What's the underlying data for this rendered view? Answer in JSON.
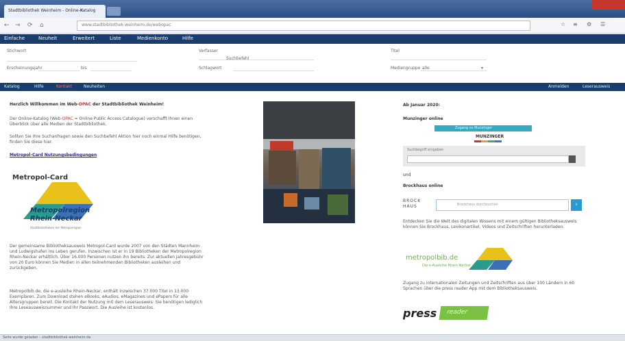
{
  "browser": {
    "tab_title": "Stadtbibliothek Weinheim - Online-Katalog",
    "tab_close": "×",
    "url": "www.stadtbibliothek-weinheim.de/webopac",
    "nav_back": "←",
    "nav_forward": "→",
    "nav_reload": "⟳",
    "nav_home": "⌂"
  },
  "catalog_nav": {
    "items": [
      "Einfache",
      "Neuheit",
      "Erweitert",
      "Liste",
      "Medienkonto",
      "Hilfe"
    ]
  },
  "search_form": {
    "fields": [
      {
        "label": "Stichwort"
      },
      {
        "label": "Verfasser"
      },
      {
        "label": "Titel"
      },
      {
        "label": "Erscheinungsjahr"
      },
      {
        "label": "Schlagwort"
      },
      {
        "label": "Mediengruppe"
      }
    ],
    "range_to": "bis",
    "mid_hint": "Suchbefehl",
    "select_placeholder": "alle"
  },
  "link_bar": {
    "left": [
      "Katalog",
      "Hilfe",
      "Kontakt",
      "Neuheiten"
    ],
    "right": [
      "Anmelden",
      "Leserausweis"
    ]
  },
  "main": {
    "welcome_prefix": "Herzlich Willkommen im Web-",
    "welcome_highlight": "OPAC",
    "welcome_suffix": " der Stadtbibliothek Weinheim!",
    "para1_prefix": "Der Online-Katalog (Web-",
    "para1_highlight": "OPAC",
    "para1_suffix": " = Online Public Access Catalogue) verschafft Ihnen einen Überblick über alle Medien der Stadtbibliothek.",
    "para2": "Sollten Sie Ihre Suchanfragen sowie den Suchbefehl Aktion hier noch einmal Hilfe benötigen, finden Sie diese hier.",
    "link": "Metropol-Card Nutzungsbedingungen",
    "metropol_card": {
      "card_label": "Metropol-Card",
      "region_line1": "Metropolregion",
      "region_line2": "Rhein-Neckar",
      "fineprint": "Stadtbibliotheken der Metropolregion"
    },
    "para3": "Der gemeinsame Bibliotheksausweis Metropol-Card wurde 2007 von den Städten Mannheim und Ludwigshafen ins Leben gerufen. Inzwischen ist er in 19 Bibliotheken der Metropolregion Rhein-Neckar erhältlich. Über 16.000 Personen nutzen ihn bereits. Zur aktuellen Jahresgebühr von 20 Euro können Sie Medien in allen teilnehmenden Bibliotheken ausleihen und zurückgeben.",
    "para4": "Metropolbib.de, die e-ausleihe Rhein-Neckar, enthält inzwischen 37.000 Titel in 13.000 Exemplaren. Zum Download stehen eBooks, eAudios, eMagazines und ePapers für alle Altersgruppen bereit. Die Kontakt der Nutzung mit dem Leserausweis: Sie benötigen lediglich Ihre Leseausweisnummer und Ihr Passwort. Die Ausleihe ist kostenlos."
  },
  "sidebar": {
    "heading_news": "Ab Januar 2020:",
    "heading_munz": "Munzinger online",
    "munzinger": {
      "bar_text": "Zugang zu Munzinger",
      "name": "MUNZINGER"
    },
    "munz_form_label": "Suchbegriff eingeben",
    "and_text": "und",
    "heading_brock": "Brockhaus online",
    "brockhaus_logo": "BROCK\nHAUS",
    "brockhaus_placeholder": "Brockhaus durchsuchen",
    "brockhaus_go": "›",
    "text_brock": "Entdecken Sie die Welt des digitalen Wissens mit einem gültigen Bibliotheksausweis können Sie Brockhaus, Lexikonartikel, Videos und Zeitschriften herunterladen.",
    "metro_logo": "metropolbib.de",
    "metro_sub": "Die e-Ausleihe Rhein-Neckar",
    "text_press": "Zugang zu internationalen Zeitungen und Zeitschriften aus über 100 Ländern in 60 Sprachen über die press reader App mit dem Bibliotheksausweis.",
    "press_word": "press",
    "reader_word": "reader"
  },
  "statusbar": {
    "text": "Seite wurde geladen – stadtbibliothek-weinheim.de"
  },
  "colors": {
    "nav_dark": "#1b3d6e",
    "tab_blue": "#2a4f86",
    "accent_red": "#c0392b",
    "munz_blue": "#36a9c1",
    "brock_blue": "#2a9bd0",
    "press_green": "#7ac143"
  }
}
